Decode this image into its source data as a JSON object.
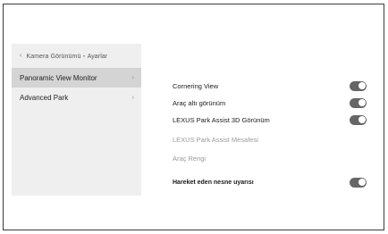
{
  "sidebar": {
    "breadcrumb_chevron": "‹",
    "breadcrumb": "Kamera Görünümü・Ayarlar",
    "items": [
      {
        "label": "Panoramic View Monitor",
        "arrow": "›",
        "active": true
      },
      {
        "label": "Advanced Park",
        "arrow": "›",
        "active": false
      }
    ]
  },
  "settings": [
    {
      "label": "Cornering View",
      "toggle": true,
      "state": "on",
      "enabled": true
    },
    {
      "label": "Araç altı görünüm",
      "toggle": true,
      "state": "on",
      "enabled": true
    },
    {
      "label": "LEXUS Park Assist 3D Görünüm",
      "toggle": true,
      "state": "on",
      "enabled": true
    },
    {
      "label": "LEXUS Park Assist Mesafesi",
      "toggle": false,
      "enabled": false
    },
    {
      "label": "Araç Rengi",
      "toggle": false,
      "enabled": false
    },
    {
      "label": "Hareket eden nesne uyarısı",
      "toggle": true,
      "state": "on",
      "enabled": true
    }
  ]
}
